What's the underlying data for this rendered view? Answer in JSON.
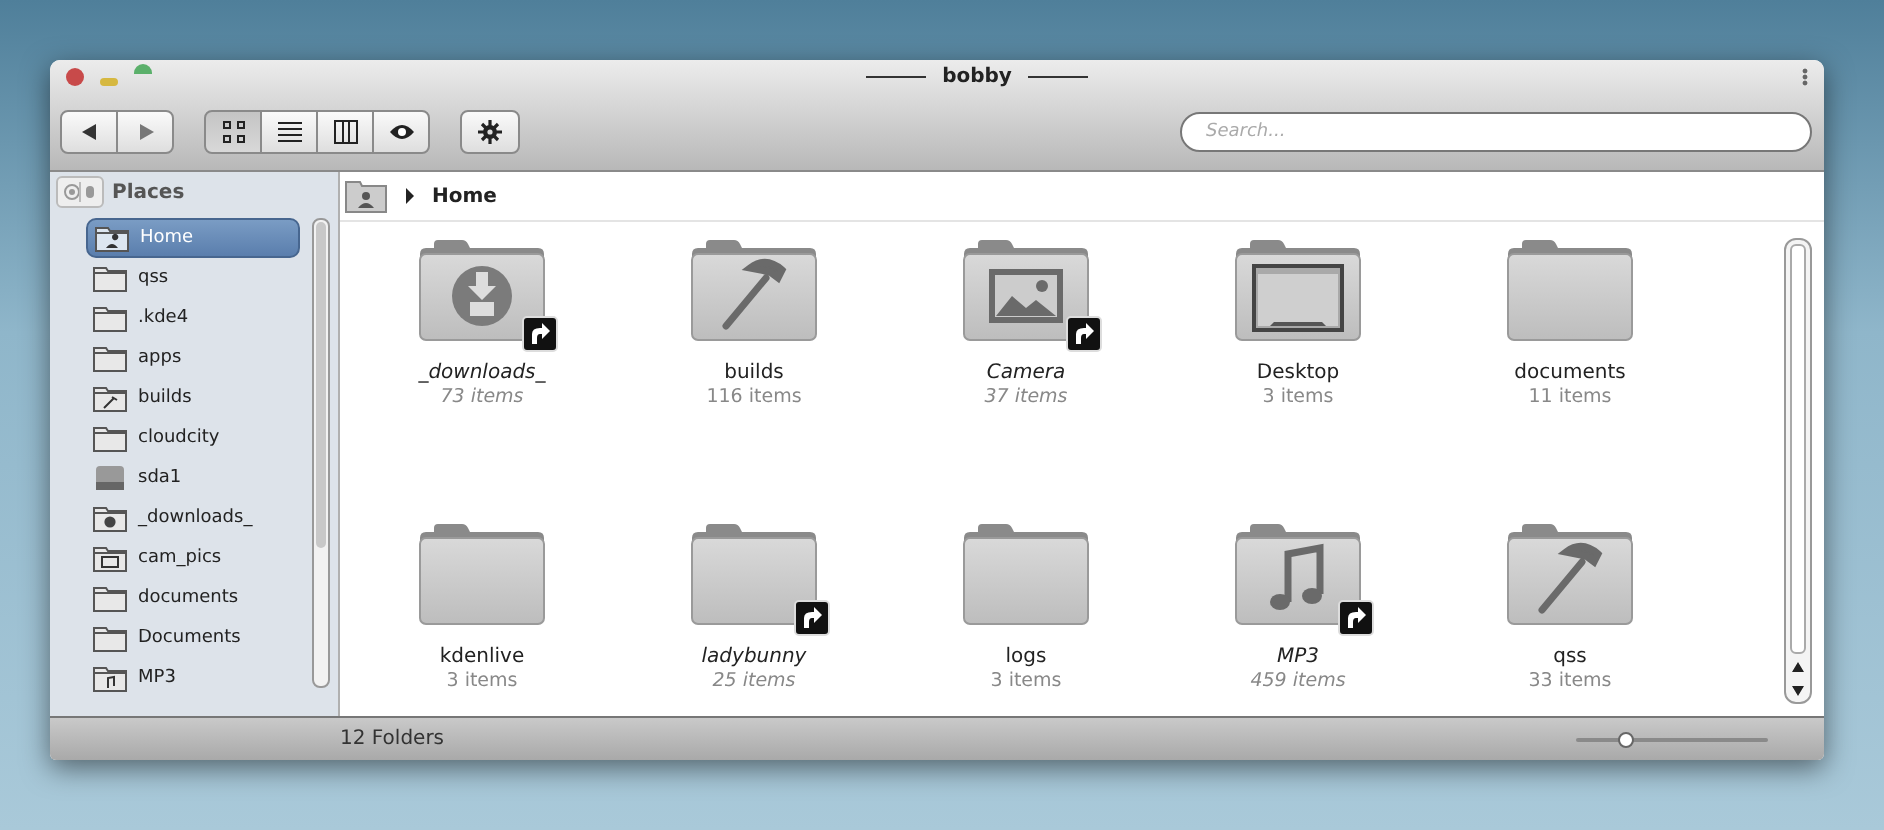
{
  "window": {
    "title": "bobby"
  },
  "toolbar": {
    "views": [
      {
        "kind": "icons",
        "selected": true
      },
      {
        "kind": "details",
        "selected": false
      },
      {
        "kind": "columns",
        "selected": false
      },
      {
        "kind": "preview",
        "selected": false
      }
    ]
  },
  "search": {
    "placeholder": "Search..."
  },
  "sidebar": {
    "title": "Places",
    "items": [
      {
        "label": "Home",
        "kind": "home",
        "selected": true
      },
      {
        "label": "qss",
        "kind": "folder",
        "selected": false
      },
      {
        "label": ".kde4",
        "kind": "folder",
        "selected": false
      },
      {
        "label": "apps",
        "kind": "folder",
        "selected": false
      },
      {
        "label": "builds",
        "kind": "builds",
        "selected": false
      },
      {
        "label": "cloudcity",
        "kind": "folder",
        "selected": false
      },
      {
        "label": "sda1",
        "kind": "drive",
        "selected": false
      },
      {
        "label": "_downloads_",
        "kind": "downloads",
        "selected": false
      },
      {
        "label": "cam_pics",
        "kind": "pictures",
        "selected": false
      },
      {
        "label": "documents",
        "kind": "folder",
        "selected": false
      },
      {
        "label": "Documents",
        "kind": "folder",
        "selected": false
      },
      {
        "label": "MP3",
        "kind": "music",
        "selected": false
      }
    ]
  },
  "breadcrumb": {
    "current": "Home"
  },
  "files": [
    {
      "name": "_downloads_",
      "count": "73 items",
      "kind": "download",
      "link": true
    },
    {
      "name": "builds",
      "count": "116 items",
      "kind": "hammer",
      "link": false
    },
    {
      "name": "Camera",
      "count": "37 items",
      "kind": "picture",
      "link": true
    },
    {
      "name": "Desktop",
      "count": "3 items",
      "kind": "desktop",
      "link": false
    },
    {
      "name": "documents",
      "count": "11 items",
      "kind": "plain",
      "link": false
    },
    {
      "name": "kdenlive",
      "count": "3 items",
      "kind": "plain",
      "link": false
    },
    {
      "name": "ladybunny",
      "count": "25 items",
      "kind": "plain",
      "link": true
    },
    {
      "name": "logs",
      "count": "3 items",
      "kind": "plain",
      "link": false
    },
    {
      "name": "MP3",
      "count": "459 items",
      "kind": "music",
      "link": true
    },
    {
      "name": "qss",
      "count": "33 items",
      "kind": "hammer",
      "link": false
    }
  ],
  "status_bar": {
    "text": "12 Folders",
    "zoom": {
      "level": 0.26
    }
  }
}
